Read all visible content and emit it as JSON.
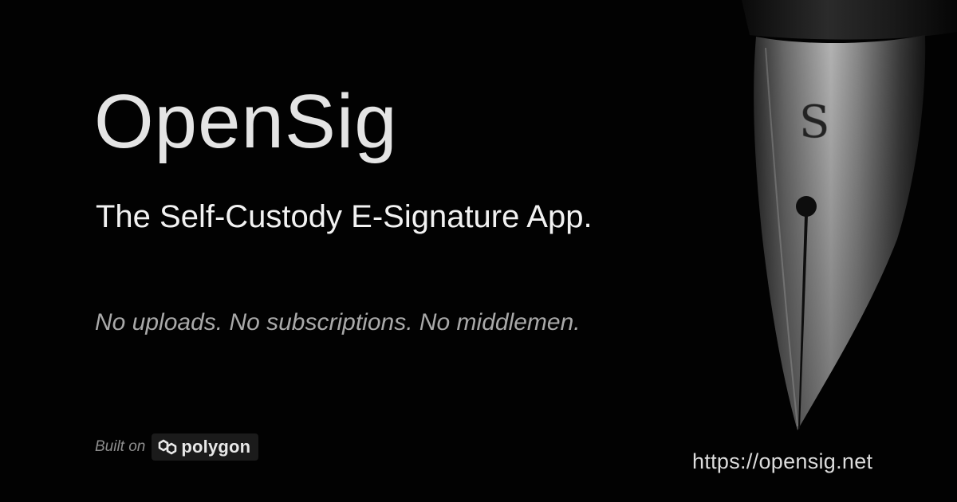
{
  "brand": {
    "title": "OpenSig",
    "tagline": "The Self-Custody E-Signature App.",
    "subline": "No uploads. No subscriptions. No middlemen."
  },
  "footer": {
    "built_label": "Built on",
    "partner_name": "polygon",
    "partner_icon": "polygon-logo-icon",
    "url": "https://opensig.net"
  },
  "colors": {
    "background": "#020202",
    "title": "#e4e4e4",
    "subline": "#a9a9a9"
  }
}
